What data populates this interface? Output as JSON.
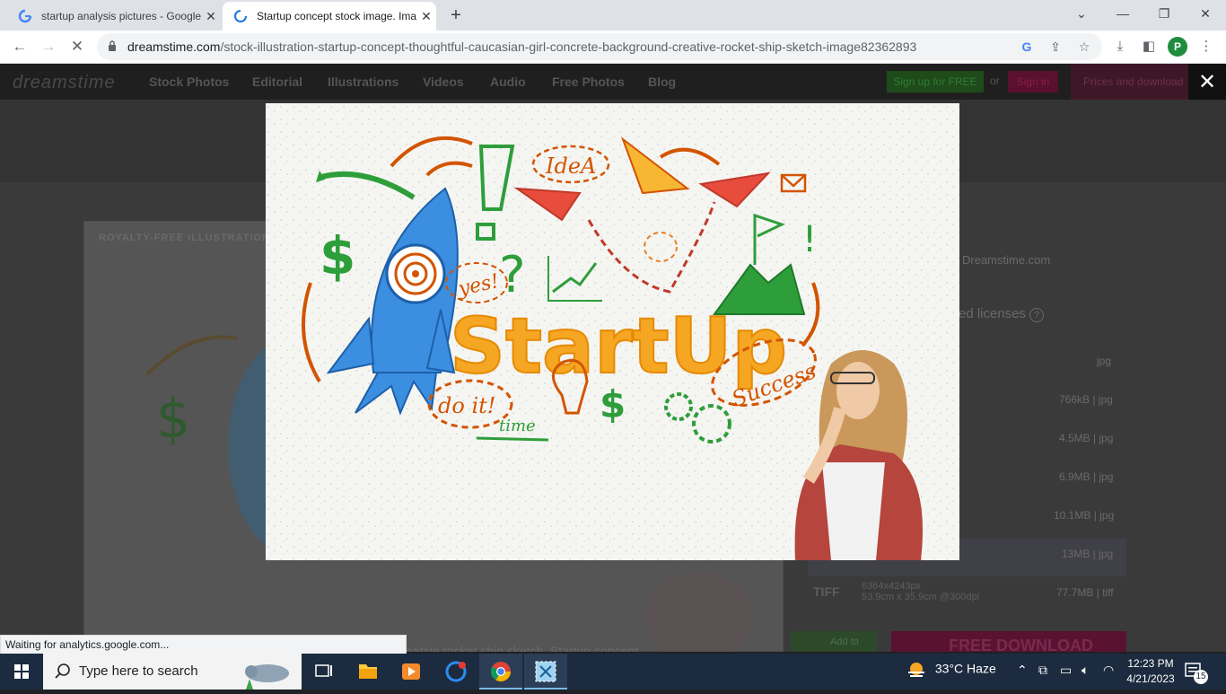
{
  "browser": {
    "tabs": [
      {
        "title": "startup analysis pictures - Google",
        "favicon": "google-icon",
        "active": false
      },
      {
        "title": "Startup concept stock image. Ima",
        "favicon": "loading-spinner-icon",
        "active": true
      }
    ],
    "url_domain": "dreamstime.com",
    "url_path": "/stock-illustration-startup-concept-thoughtful-caucasian-girl-concrete-background-creative-rocket-ship-sketch-image82362893",
    "profile_initial": "P",
    "status_text": "Waiting for analytics.google.com..."
  },
  "site": {
    "logo": "dreamstime",
    "nav": [
      "Stock Photos",
      "Editorial",
      "Illustrations",
      "Videos",
      "Audio",
      "Free Photos",
      "Blog"
    ],
    "signup": "Sign up for FREE",
    "or": "or",
    "signin": "Sign in",
    "prices": "Prices and download",
    "close_glyph": "✕",
    "royalty_free_label": "ROYALTY-FREE ILLUSTRATION",
    "credit": "Dreamstime.com",
    "licenses": "ed licenses",
    "sizes": [
      "jpg",
      "766kB | jpg",
      "4.5MB | jpg",
      "6.9MB | jpg",
      "10.1MB | jpg",
      "13MB | jpg",
      "77.7MB | tiff"
    ],
    "tiff_label": "TIFF",
    "tiff_res_1": "6364x4243px",
    "tiff_res_2": "53.9cm x 35.9cm @300dpi",
    "add_to": "Add to",
    "free_download": "FREE DOWNLOAD",
    "caption": "eative rocket ship sketch. Startup concept"
  },
  "lightbox": {
    "headline": "StartUp",
    "words": [
      "IdeA",
      "yes!",
      "do it!",
      "time",
      "Success"
    ]
  },
  "taskbar": {
    "search_placeholder": "Type here to search",
    "weather": "33°C  Haze",
    "time": "12:23 PM",
    "date": "4/21/2023",
    "notif_count": "15"
  }
}
